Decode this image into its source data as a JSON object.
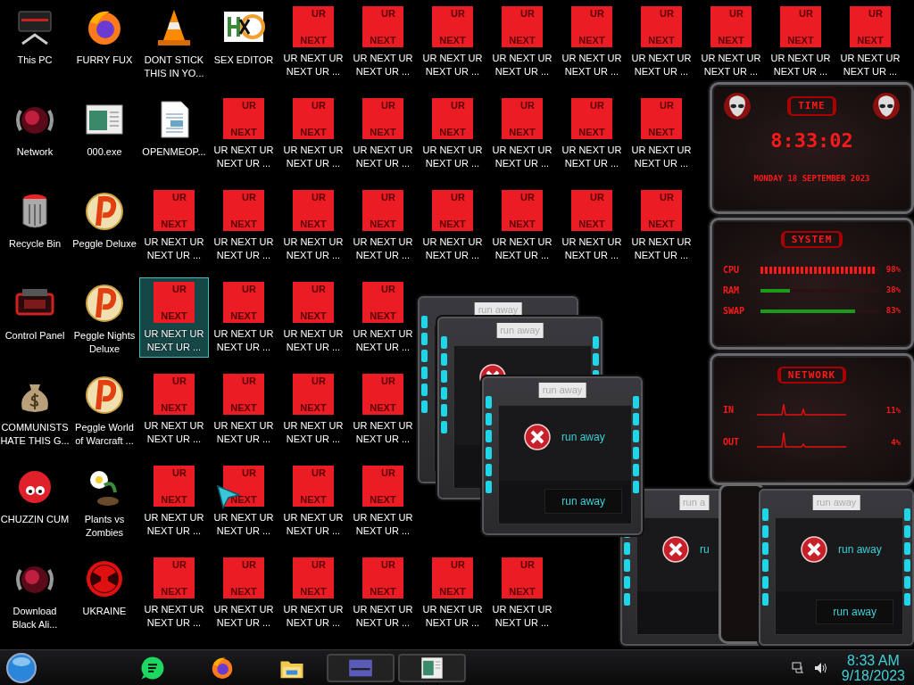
{
  "desktop_icons": [
    {
      "icons": [
        {
          "kind": "monitor",
          "label": "This PC",
          "selected": false
        },
        {
          "kind": "firefox",
          "label": "FURRY FUX",
          "selected": false
        },
        {
          "kind": "cone",
          "label": "DONT STICK THIS IN YO...",
          "selected": false
        },
        {
          "kind": "hxd",
          "label": "SEX EDITOR",
          "selected": false
        },
        {
          "kind": "urnext",
          "tile": [
            "UR",
            "NEXT"
          ],
          "label": "UR NEXT UR NEXT UR ...",
          "selected": false
        },
        {
          "kind": "urnext",
          "tile": [
            "UR",
            "NEXT"
          ],
          "label": "UR NEXT UR NEXT UR ...",
          "selected": false
        },
        {
          "kind": "urnext",
          "tile": [
            "UR",
            "NEXT"
          ],
          "label": "UR NEXT UR NEXT UR ...",
          "selected": false
        },
        {
          "kind": "urnext",
          "tile": [
            "UR",
            "NEXT"
          ],
          "label": "UR NEXT UR NEXT UR ...",
          "selected": false
        },
        {
          "kind": "urnext",
          "tile": [
            "UR",
            "NEXT"
          ],
          "label": "UR NEXT UR NEXT UR ...",
          "selected": false
        },
        {
          "kind": "urnext",
          "tile": [
            "UR",
            "NEXT"
          ],
          "label": "UR NEXT UR NEXT UR ...",
          "selected": false
        },
        {
          "kind": "urnext",
          "tile": [
            "UR",
            "NEXT"
          ],
          "label": "UR NEXT UR NEXT UR ...",
          "selected": false
        },
        {
          "kind": "urnext",
          "tile": [
            "UR",
            "NEXT"
          ],
          "label": "UR NEXT UR NEXT UR ...",
          "selected": false
        },
        {
          "kind": "urnext",
          "tile": [
            "UR",
            "NEXT"
          ],
          "label": "UR NEXT UR NEXT UR ...",
          "selected": false
        }
      ]
    },
    {
      "icons": [
        {
          "kind": "orb",
          "label": "Network",
          "selected": false
        },
        {
          "kind": "window",
          "label": "000.exe",
          "selected": false
        },
        {
          "kind": "document",
          "label": "OPENMEOP...",
          "selected": false
        },
        {
          "kind": "urnext",
          "tile": [
            "UR",
            "NEXT"
          ],
          "label": "UR NEXT UR NEXT UR ...",
          "selected": false
        },
        {
          "kind": "urnext",
          "tile": [
            "UR",
            "NEXT"
          ],
          "label": "UR NEXT UR NEXT UR ...",
          "selected": false
        },
        {
          "kind": "urnext",
          "tile": [
            "UR",
            "NEXT"
          ],
          "label": "UR NEXT UR NEXT UR ...",
          "selected": false
        },
        {
          "kind": "urnext",
          "tile": [
            "UR",
            "NEXT"
          ],
          "label": "UR NEXT UR NEXT UR ...",
          "selected": false
        },
        {
          "kind": "urnext",
          "tile": [
            "UR",
            "NEXT"
          ],
          "label": "UR NEXT UR NEXT UR ...",
          "selected": false
        },
        {
          "kind": "urnext",
          "tile": [
            "UR",
            "NEXT"
          ],
          "label": "UR NEXT UR NEXT UR ...",
          "selected": false
        },
        {
          "kind": "urnext",
          "tile": [
            "UR",
            "NEXT"
          ],
          "label": "UR NEXT UR NEXT UR ...",
          "selected": false
        }
      ]
    },
    {
      "icons": [
        {
          "kind": "bin",
          "label": "Recycle Bin",
          "selected": false
        },
        {
          "kind": "peggle",
          "label": "Peggle Deluxe",
          "selected": false
        },
        {
          "kind": "urnext",
          "tile": [
            "UR",
            "NEXT"
          ],
          "label": "UR NEXT UR NEXT UR ...",
          "selected": false
        },
        {
          "kind": "urnext",
          "tile": [
            "UR",
            "NEXT"
          ],
          "label": "UR NEXT UR NEXT UR ...",
          "selected": false
        },
        {
          "kind": "urnext",
          "tile": [
            "UR",
            "NEXT"
          ],
          "label": "UR NEXT UR NEXT UR ...",
          "selected": false
        },
        {
          "kind": "urnext",
          "tile": [
            "UR",
            "NEXT"
          ],
          "label": "UR NEXT UR NEXT UR ...",
          "selected": false
        },
        {
          "kind": "urnext",
          "tile": [
            "UR",
            "NEXT"
          ],
          "label": "UR NEXT UR NEXT UR ...",
          "selected": false
        },
        {
          "kind": "urnext",
          "tile": [
            "UR",
            "NEXT"
          ],
          "label": "UR NEXT UR NEXT UR ...",
          "selected": false
        },
        {
          "kind": "urnext",
          "tile": [
            "UR",
            "NEXT"
          ],
          "label": "UR NEXT UR NEXT UR ...",
          "selected": false
        },
        {
          "kind": "urnext",
          "tile": [
            "UR",
            "NEXT"
          ],
          "label": "UR NEXT UR NEXT UR ...",
          "selected": false
        }
      ]
    },
    {
      "icons": [
        {
          "kind": "controlpanel",
          "label": "Control Panel",
          "selected": false
        },
        {
          "kind": "peggle",
          "label": "Peggle Nights Deluxe",
          "selected": false
        },
        {
          "kind": "urnext",
          "tile": [
            "UR",
            "NEXT"
          ],
          "label": "UR NEXT UR NEXT UR ...",
          "selected": true
        },
        {
          "kind": "urnext",
          "tile": [
            "UR",
            "NEXT"
          ],
          "label": "UR NEXT UR NEXT UR ...",
          "selected": false
        },
        {
          "kind": "urnext",
          "tile": [
            "UR",
            "NEXT"
          ],
          "label": "UR NEXT UR NEXT UR ...",
          "selected": false
        },
        {
          "kind": "urnext",
          "tile": [
            "UR",
            "NEXT"
          ],
          "label": "UR NEXT UR NEXT UR ...",
          "selected": false
        }
      ]
    },
    {
      "icons": [
        {
          "kind": "moneybag",
          "label": "COMMUNISTS HATE THIS G...",
          "selected": false
        },
        {
          "kind": "peggle",
          "label": "Peggle World of Warcraft ...",
          "selected": false
        },
        {
          "kind": "urnext",
          "tile": [
            "UR",
            "NEXT"
          ],
          "label": "UR NEXT UR NEXT UR ...",
          "selected": false
        },
        {
          "kind": "urnext",
          "tile": [
            "UR",
            "NEXT"
          ],
          "label": "UR NEXT UR NEXT UR ...",
          "selected": false
        },
        {
          "kind": "urnext",
          "tile": [
            "UR",
            "NEXT"
          ],
          "label": "UR NEXT UR NEXT UR ...",
          "selected": false
        },
        {
          "kind": "urnext",
          "tile": [
            "UR",
            "NEXT"
          ],
          "label": "UR NEXT UR NEXT UR ...",
          "selected": false
        }
      ]
    },
    {
      "icons": [
        {
          "kind": "fuzzball",
          "label": "CHUZZIN CUM",
          "selected": false
        },
        {
          "kind": "plant",
          "label": "Plants vs Zombies",
          "selected": false
        },
        {
          "kind": "urnext",
          "tile": [
            "UR",
            "NEXT"
          ],
          "label": "UR NEXT UR NEXT UR ...",
          "selected": false
        },
        {
          "kind": "urnext",
          "tile": [
            "UR",
            "NEXT"
          ],
          "label": "UR NEXT UR NEXT UR ...",
          "selected": false
        },
        {
          "kind": "urnext",
          "tile": [
            "UR",
            "NEXT"
          ],
          "label": "UR NEXT UR NEXT UR ...",
          "selected": false
        },
        {
          "kind": "urnext",
          "tile": [
            "UR",
            "NEXT"
          ],
          "label": "UR NEXT UR NEXT UR ...",
          "selected": false
        }
      ]
    },
    {
      "icons": [
        {
          "kind": "orb",
          "label": "Download Black Ali...",
          "selected": false
        },
        {
          "kind": "radiation",
          "label": "UKRAINE",
          "selected": false
        },
        {
          "kind": "urnext",
          "tile": [
            "UR",
            "NEXT"
          ],
          "label": "UR NEXT UR NEXT UR ...",
          "selected": false
        },
        {
          "kind": "urnext",
          "tile": [
            "UR",
            "NEXT"
          ],
          "label": "UR NEXT UR NEXT UR ...",
          "selected": false
        },
        {
          "kind": "urnext",
          "tile": [
            "UR",
            "NEXT"
          ],
          "label": "UR NEXT UR NEXT UR ...",
          "selected": false
        },
        {
          "kind": "urnext",
          "tile": [
            "UR",
            "NEXT"
          ],
          "label": "UR NEXT UR NEXT UR ...",
          "selected": false
        },
        {
          "kind": "urnext",
          "tile": [
            "UR",
            "NEXT"
          ],
          "label": "UR NEXT UR NEXT UR ...",
          "selected": false
        },
        {
          "kind": "urnext",
          "tile": [
            "UR",
            "NEXT"
          ],
          "label": "UR NEXT UR NEXT UR ...",
          "selected": false
        }
      ]
    }
  ],
  "dialogs_back": [
    {
      "title": "run away",
      "error": false
    },
    {
      "title": "run away",
      "error": true
    },
    {
      "title": "run a",
      "error": true,
      "message": "ru"
    },
    {
      "title": "run away",
      "error": true,
      "message": "run away",
      "button": "run away"
    }
  ],
  "widget": {
    "time": {
      "title": "TIME",
      "clock": "8:33:02",
      "date": "MONDAY 18 SEPTEMBER 2023"
    },
    "system": {
      "title": "SYSTEM",
      "meters": [
        {
          "label": "CPU",
          "kind": "chevrons",
          "level": 0.97,
          "reading": "98%"
        },
        {
          "label": "RAM",
          "kind": "line",
          "level": 0.25,
          "reading": "38%"
        },
        {
          "label": "SWAP",
          "kind": "line",
          "level": 0.8,
          "reading": "83%"
        }
      ]
    },
    "network": {
      "title": "NETWORK",
      "rows": [
        {
          "label": "IN",
          "reading": "11%"
        },
        {
          "label": "OUT",
          "reading": "4%"
        }
      ]
    }
  },
  "dialogs_front": [
    {
      "title": "run away",
      "error": true,
      "message": "run away",
      "button": "run away"
    }
  ],
  "taskbar": {
    "apps": [
      {
        "kind": "chat"
      },
      {
        "kind": "firefox"
      },
      {
        "kind": "folder"
      },
      {
        "kind": "thumb-card"
      },
      {
        "kind": "thumb-window"
      }
    ],
    "clock": {
      "time": "8:33 AM",
      "date": "9/18/2023"
    }
  }
}
